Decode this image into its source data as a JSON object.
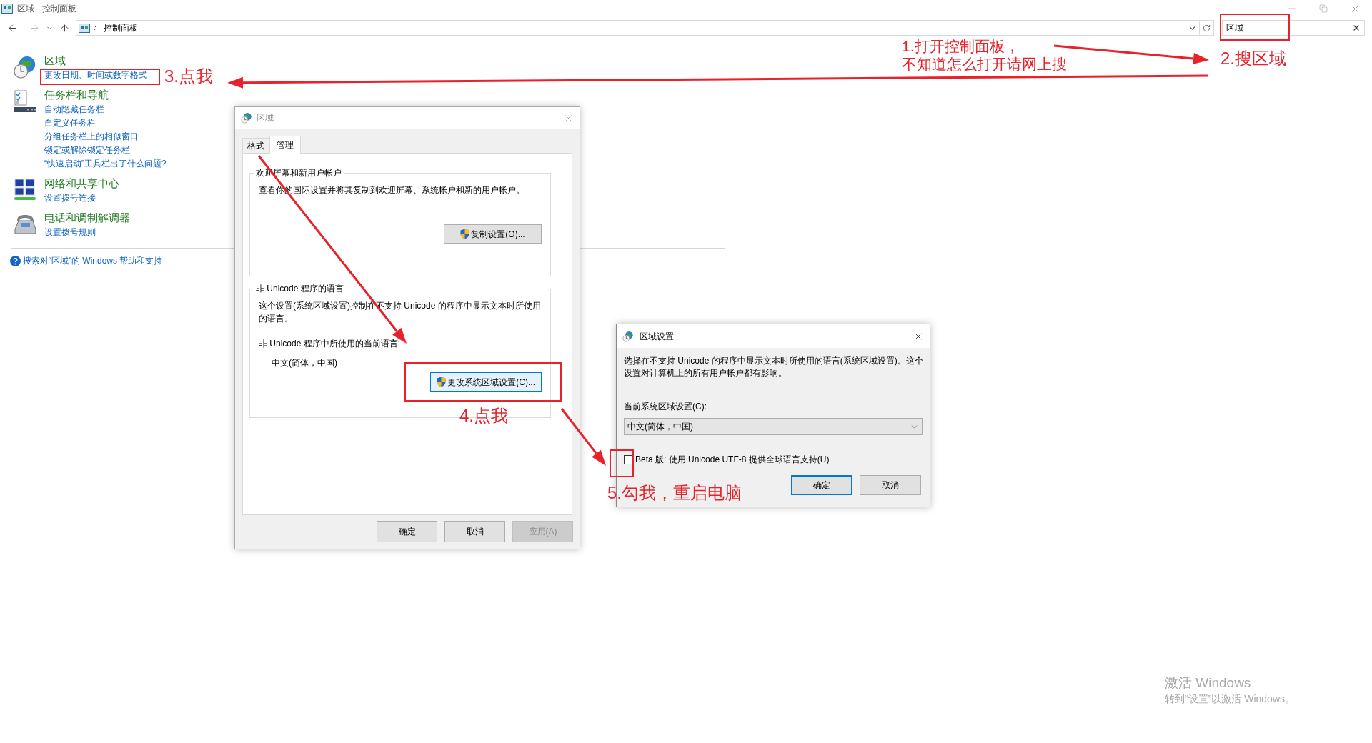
{
  "window": {
    "title": "区域 - 控制面板"
  },
  "address_bar": {
    "breadcrumb": [
      "控制面板"
    ]
  },
  "search": {
    "value": "区域"
  },
  "results": [
    {
      "kind": "region",
      "title": "区域",
      "links": [
        "更改日期、时间或数字格式"
      ]
    },
    {
      "kind": "taskbar",
      "title": "任务栏和导航",
      "links": [
        "自动隐藏任务栏",
        "自定义任务栏",
        "分组任务栏上的相似窗口",
        "锁定或解除锁定任务栏",
        "“快速启动”工具栏出了什么问题?"
      ]
    },
    {
      "kind": "network",
      "title": "网络和共享中心",
      "links": [
        "设置拨号连接"
      ]
    },
    {
      "kind": "phone",
      "title": "电话和调制解调器",
      "links": [
        "设置拨号规则"
      ]
    }
  ],
  "help_link": "搜索对“区域”的 Windows 帮助和支持",
  "region_dialog": {
    "title": "区域",
    "tabs": [
      {
        "label": "格式",
        "selected": false
      },
      {
        "label": "管理",
        "selected": true
      }
    ],
    "groups": [
      {
        "title": "欢迎屏幕和新用户帐户",
        "text": "查看你的国际设置并将其复制到欢迎屏幕、系统帐户和新的用户帐户。",
        "button": {
          "label": "复制设置(O)...",
          "highlighted": false
        }
      },
      {
        "title": "非 Unicode 程序的语言",
        "text": "这个设置(系统区域设置)控制在不支持 Unicode 的程序中显示文本时所使用的语言。",
        "label": "非 Unicode 程序中所使用的当前语言:",
        "value": "中文(简体，中国)",
        "button": {
          "label": "更改系统区域设置(C)...",
          "highlighted": true
        }
      }
    ],
    "buttons": [
      {
        "label": "确定",
        "disabled": false
      },
      {
        "label": "取消",
        "disabled": false
      },
      {
        "label": "应用(A)",
        "disabled": true
      }
    ]
  },
  "region_settings_dialog": {
    "title": "区域设置",
    "text": "选择在不支持 Unicode 的程序中显示文本时所使用的语言(系统区域设置)。这个设置对计算机上的所有用户帐户都有影响。",
    "locale_label": "当前系统区域设置(C):",
    "locale_value": "中文(简体，中国)",
    "checkbox": {
      "label": "Beta 版: 使用 Unicode UTF-8 提供全球语言支持(U)",
      "checked": false
    },
    "buttons": [
      {
        "label": "确定",
        "default": true
      },
      {
        "label": "取消",
        "default": false
      }
    ]
  },
  "annotations": [
    {
      "lines": [
        "1.打开控制面板，",
        "不知道怎么打开请网上搜"
      ]
    },
    {
      "lines": [
        "2.搜区域"
      ]
    },
    {
      "lines": [
        "3.点我"
      ]
    },
    {
      "lines": [
        "4.点我"
      ]
    },
    {
      "lines": [
        "5.勾我，重启电脑"
      ]
    }
  ],
  "activation_notice": {
    "title": "激活 Windows",
    "text": "转到“设置”以激活 Windows。"
  }
}
